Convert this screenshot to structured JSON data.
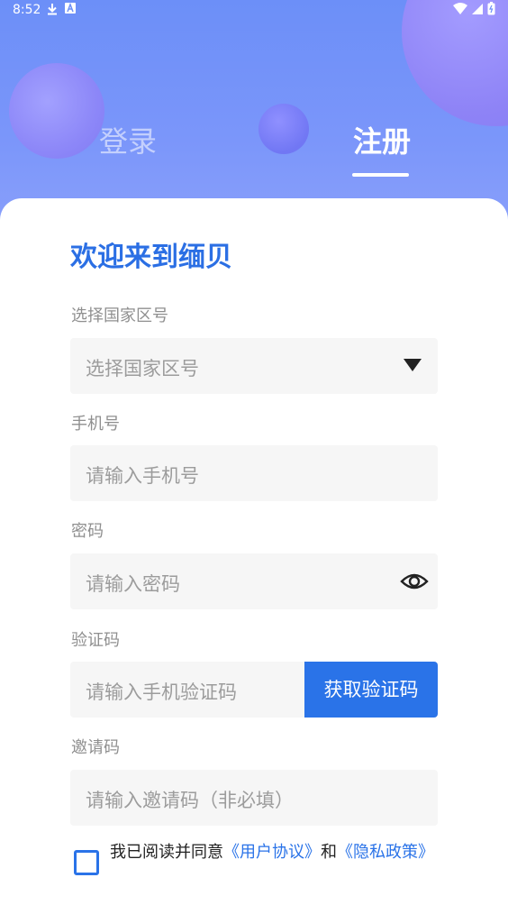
{
  "status_bar": {
    "time": "8:52",
    "icons": [
      "download-icon",
      "font-a-icon"
    ],
    "right_icons": [
      "wifi-icon",
      "signal-icon",
      "battery-icon"
    ]
  },
  "tabs": {
    "login": "登录",
    "register": "注册",
    "active": "register"
  },
  "form": {
    "title": "欢迎来到缅贝",
    "country": {
      "label": "选择国家区号",
      "placeholder": "选择国家区号"
    },
    "phone": {
      "label": "手机号",
      "placeholder": "请输入手机号"
    },
    "password": {
      "label": "密码",
      "placeholder": "请输入密码"
    },
    "code": {
      "label": "验证码",
      "placeholder": "请输入手机验证码",
      "button": "获取验证码"
    },
    "invite": {
      "label": "邀请码",
      "placeholder": "请输入邀请码（非必填）"
    },
    "agreement": {
      "prefix": "我已阅读并同意",
      "user_agreement": "《用户协议》",
      "and": "和",
      "privacy_policy": "《隐私政策》",
      "checked": false
    }
  },
  "colors": {
    "accent": "#2a73e8",
    "header_gradient_top": "#6c8ff8",
    "header_gradient_bottom": "#8aa0fb"
  }
}
